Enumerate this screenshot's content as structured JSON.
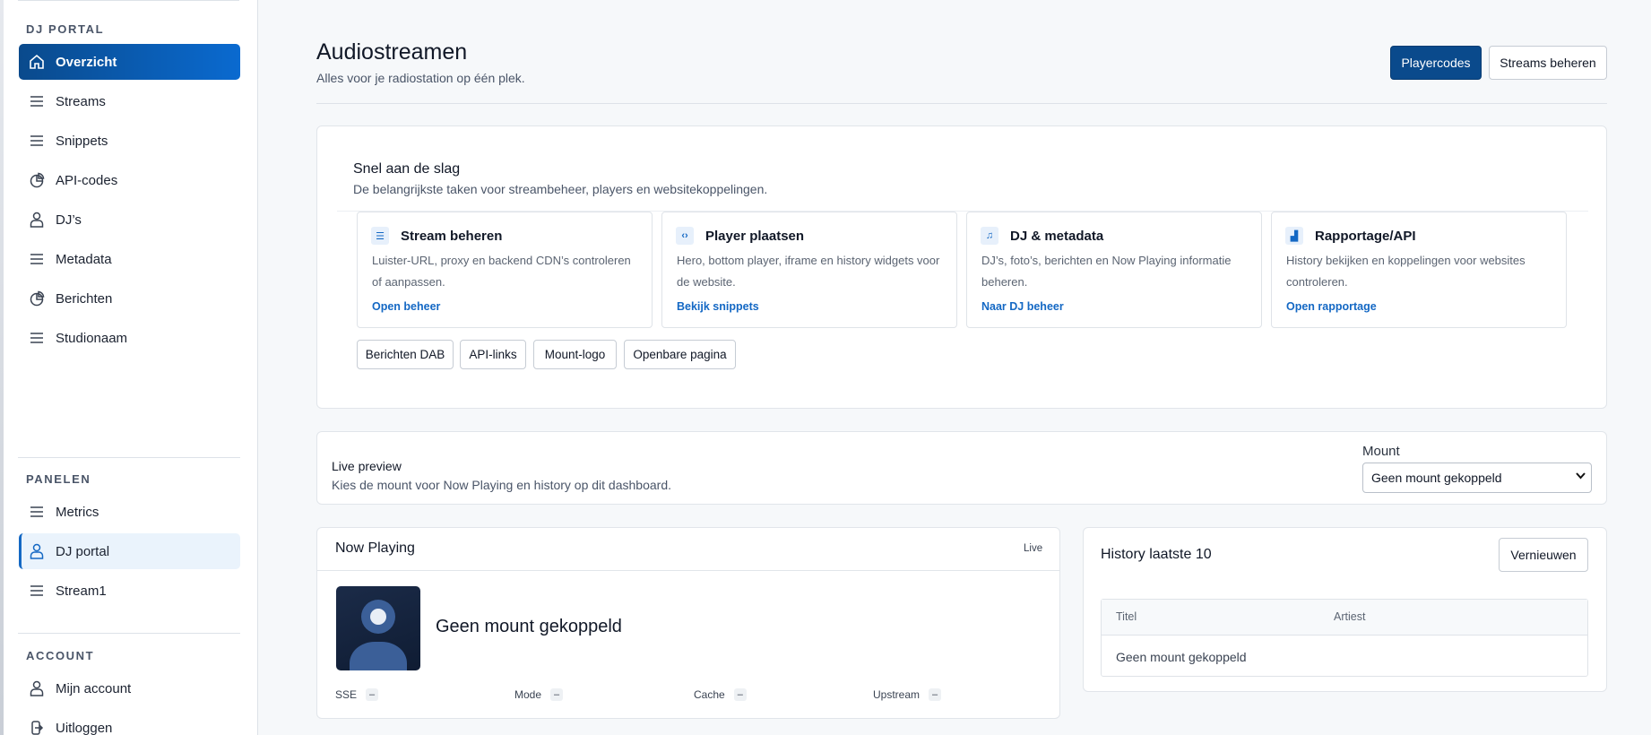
{
  "sidebar": {
    "sections": {
      "portal": "DJ PORTAL",
      "panels": "PANELEN",
      "account": "ACCOUNT"
    },
    "portal_items": [
      {
        "label": "Overzicht",
        "icon": "home-icon"
      },
      {
        "label": "Streams",
        "icon": "list-icon"
      },
      {
        "label": "Snippets",
        "icon": "list-icon"
      },
      {
        "label": "API-codes",
        "icon": "pie-chart-icon"
      },
      {
        "label": "DJ’s",
        "icon": "user-icon"
      },
      {
        "label": "Metadata",
        "icon": "list-icon"
      },
      {
        "label": "Berichten",
        "icon": "pie-chart-icon"
      },
      {
        "label": "Studionaam",
        "icon": "list-icon"
      }
    ],
    "panel_items": [
      {
        "label": "Metrics",
        "icon": "list-icon"
      },
      {
        "label": "DJ portal",
        "icon": "user-icon"
      },
      {
        "label": "Stream1",
        "icon": "list-icon"
      }
    ],
    "account_items": [
      {
        "label": "Mijn account",
        "icon": "user-icon"
      },
      {
        "label": "Uitloggen",
        "icon": "logout-icon"
      }
    ]
  },
  "header": {
    "title": "Audiostreamen",
    "subtitle": "Alles voor je radiostation op één plek.",
    "primary_button": "Playercodes",
    "secondary_button": "Streams beheren"
  },
  "quickstart": {
    "title": "Snel aan de slag",
    "subtitle": "De belangrijkste taken voor streambeheer, players en websitekoppelingen.",
    "tiles": [
      {
        "icon": "sliders-icon",
        "glyph": "☰",
        "title": "Stream beheren",
        "desc": "Luister-URL, proxy en backend CDN’s controleren of aanpassen.",
        "link": "Open beheer"
      },
      {
        "icon": "code-icon",
        "glyph": "‹›",
        "title": "Player plaatsen",
        "desc": "Hero, bottom player, iframe en history widgets voor de website.",
        "link": "Bekijk snippets"
      },
      {
        "icon": "headphones-icon",
        "glyph": "♫",
        "title": "DJ & metadata",
        "desc": "DJ’s, foto’s, berichten en Now Playing informatie beheren.",
        "link": "Naar DJ beheer"
      },
      {
        "icon": "chart-icon",
        "glyph": "▟",
        "title": "Rapportage/API",
        "desc": "History bekijken en koppelingen voor websites controleren.",
        "link": "Open rapportage"
      }
    ],
    "chips": [
      "Berichten DAB",
      "API-links",
      "Mount-logo",
      "Openbare pagina"
    ]
  },
  "live_preview": {
    "title": "Live preview",
    "subtitle": "Kies de mount voor Now Playing en history op dit dashboard.",
    "mount_label": "Mount",
    "mount_value": "Geen mount gekoppeld"
  },
  "now_playing": {
    "title": "Now Playing",
    "badge": "Live",
    "track": "Geen mount gekoppeld",
    "stats": [
      {
        "label": "SSE",
        "value": "–"
      },
      {
        "label": "Mode",
        "value": "–"
      },
      {
        "label": "Cache",
        "value": "–"
      },
      {
        "label": "Upstream",
        "value": "–"
      }
    ]
  },
  "history": {
    "title": "History laatste 10",
    "refresh_button": "Vernieuwen",
    "columns": [
      "Titel",
      "Artiest"
    ],
    "empty_row": "Geen mount gekoppeld"
  },
  "colors": {
    "accent": "#0a4a8c",
    "link": "#1468c4"
  }
}
